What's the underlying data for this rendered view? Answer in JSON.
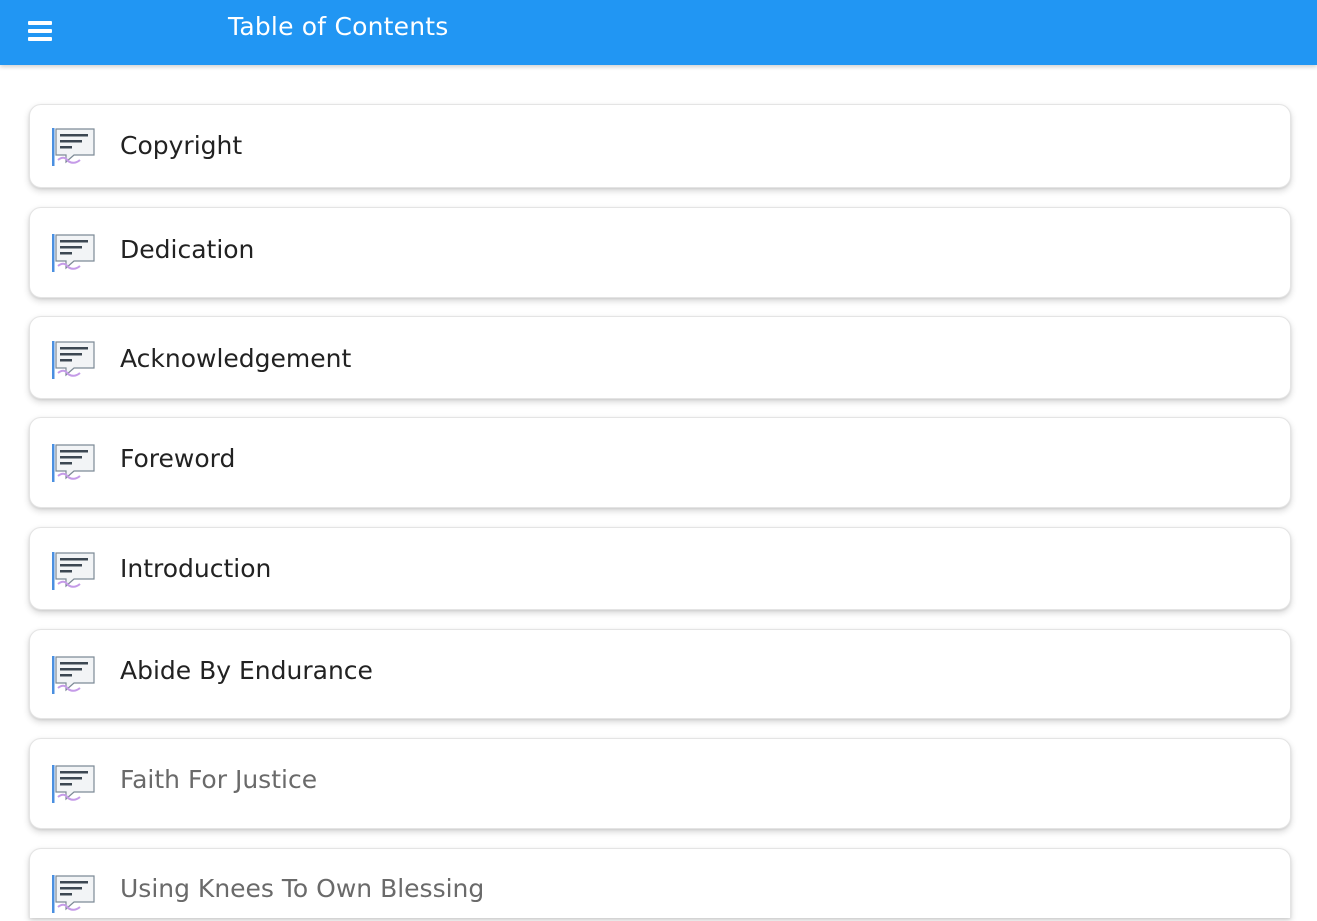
{
  "app_bar": {
    "title": "Table of Contents",
    "menu_icon": "hamburger-menu-icon",
    "color": "#2196f3"
  },
  "toc": {
    "item_icon": "book-chapter-icon",
    "items": [
      {
        "label": "Copyright"
      },
      {
        "label": "Dedication"
      },
      {
        "label": "Acknowledgement"
      },
      {
        "label": "Foreword"
      },
      {
        "label": "Introduction"
      },
      {
        "label": "Abide By Endurance"
      },
      {
        "label": "Faith For Justice"
      },
      {
        "label": "Using Knees To Own Blessing"
      }
    ]
  }
}
